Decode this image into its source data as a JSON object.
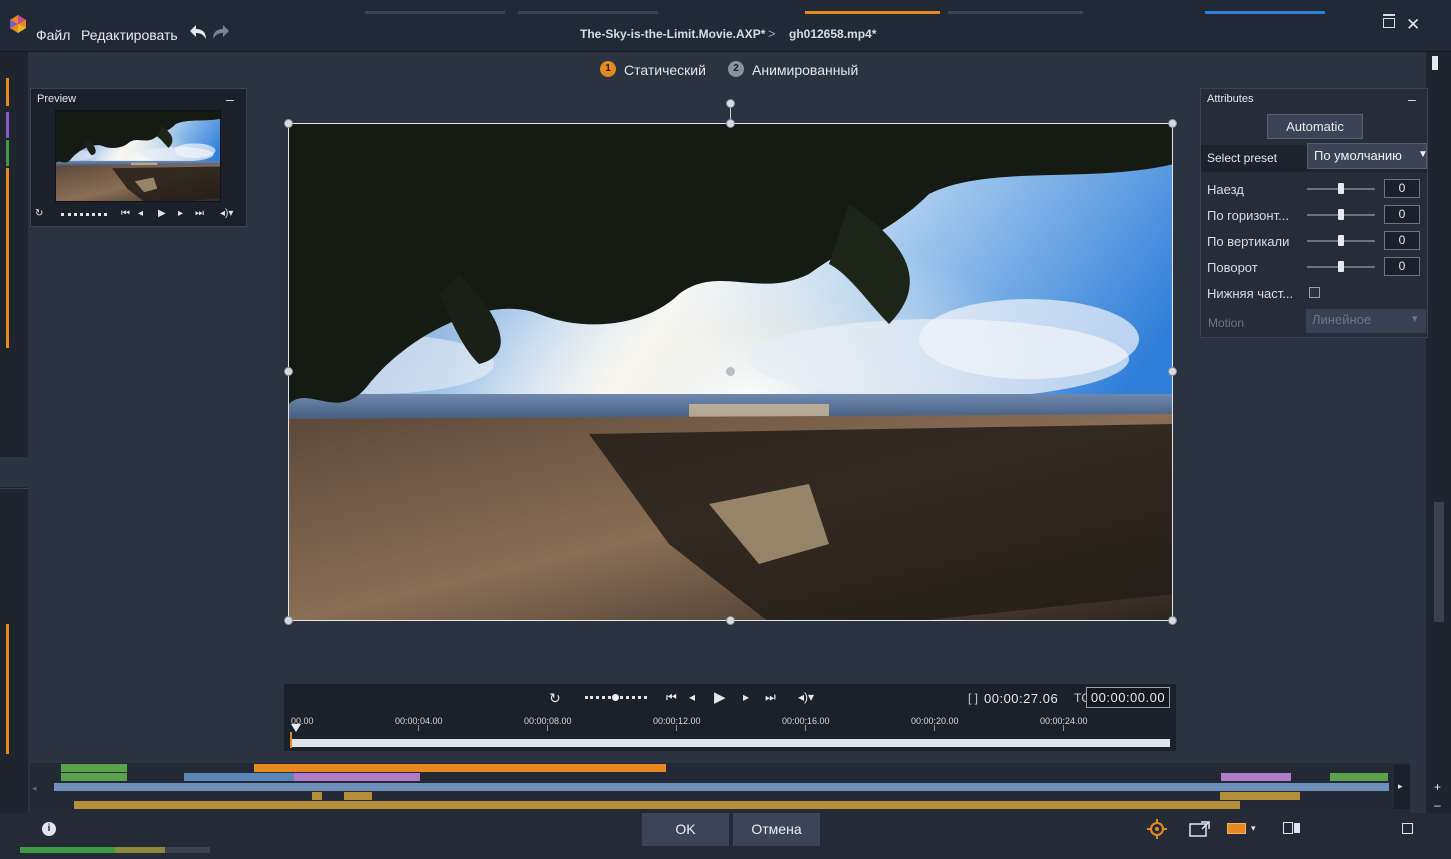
{
  "menu": {
    "file": "Файл",
    "edit": "Редактировать"
  },
  "breadcrumb": {
    "project": "The-Sky-is-the-Limit.Movie.AXP*",
    "separator": ">",
    "clip": "gh012658.mp4*"
  },
  "mode_tabs": [
    {
      "number": "1",
      "label": "Статический",
      "active": true
    },
    {
      "number": "2",
      "label": "Анимированный",
      "active": false
    }
  ],
  "preview": {
    "title": "Preview",
    "collapse": "–",
    "controls": {
      "loop": "↻",
      "first": "⏮",
      "prev": "◂",
      "play": "▶",
      "next": "▸",
      "last": "⏭",
      "volume": "◂)▾"
    }
  },
  "attributes": {
    "title": "Attributes",
    "collapse": "–",
    "automatic_label": "Automatic",
    "preset_label": "Select preset",
    "preset_value": "По умолчанию",
    "preset_arrow": "▼",
    "rows": [
      {
        "label": "Наезд",
        "value": "0",
        "level": 0.5
      },
      {
        "label": "По горизонт...",
        "value": "0",
        "level": 0.5
      },
      {
        "label": "По вертикали",
        "value": "0",
        "level": 0.5
      },
      {
        "label": "Поворот",
        "value": "0",
        "level": 0.5
      }
    ],
    "bottom_part_label": "Нижняя част...",
    "bottom_part_checked": false,
    "motion_label": "Motion",
    "motion_value": "Линейное",
    "motion_arrow": "▾"
  },
  "transport": {
    "loop": "↻",
    "first": "⏮",
    "prev": "◂",
    "play": "▶",
    "next": "▸",
    "last": "⏭",
    "volume": "◂)▾",
    "bracket": "[ ]",
    "duration": "00:00:27.06",
    "tc_label": "TC",
    "tc_value": "00:00:00.00",
    "ruler": [
      "00.00",
      "00:00:04.00",
      "00:00:08.00",
      "00:00:12.00",
      "00:00:16.00",
      "00:00:20.00",
      "00:00:24.00"
    ]
  },
  "footer": {
    "info": "i",
    "ok": "OK",
    "cancel": "Отмена"
  },
  "colors": {
    "accent": "#e8891f",
    "background": "#2b3240",
    "panel": "#262d39"
  }
}
